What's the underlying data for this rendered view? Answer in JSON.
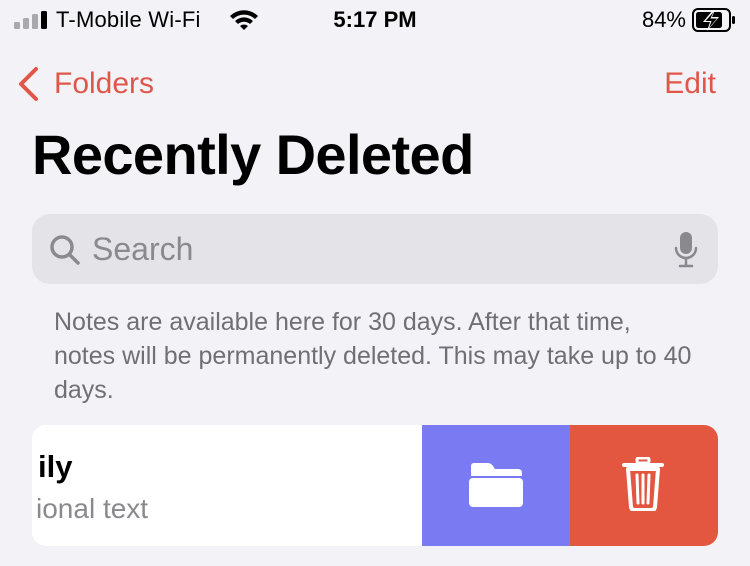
{
  "status_bar": {
    "carrier": "T-Mobile Wi-Fi",
    "time": "5:17 PM",
    "battery_percent": "84%",
    "signal_bars_active": 2,
    "battery_level": 0.84,
    "charging": true,
    "icons": [
      "signal-icon",
      "wifi-icon",
      "battery-charging-icon"
    ]
  },
  "nav": {
    "back_label": "Folders",
    "edit_label": "Edit",
    "accent_color": "#e0574a"
  },
  "page": {
    "title": "Recently Deleted"
  },
  "search": {
    "placeholder": "Search",
    "value": "",
    "icons": [
      "search-icon",
      "microphone-icon"
    ]
  },
  "info_text": "Notes are available here for 30 days. After that time, notes will be permanently deleted. This may take up to 40 days.",
  "notes": [
    {
      "title_visible": "ily",
      "subtitle_visible": "ional text",
      "actions": [
        {
          "name": "move",
          "icon": "folder-icon",
          "color": "#7a7af2"
        },
        {
          "name": "delete",
          "icon": "trash-icon",
          "color": "#e35640"
        }
      ]
    }
  ]
}
